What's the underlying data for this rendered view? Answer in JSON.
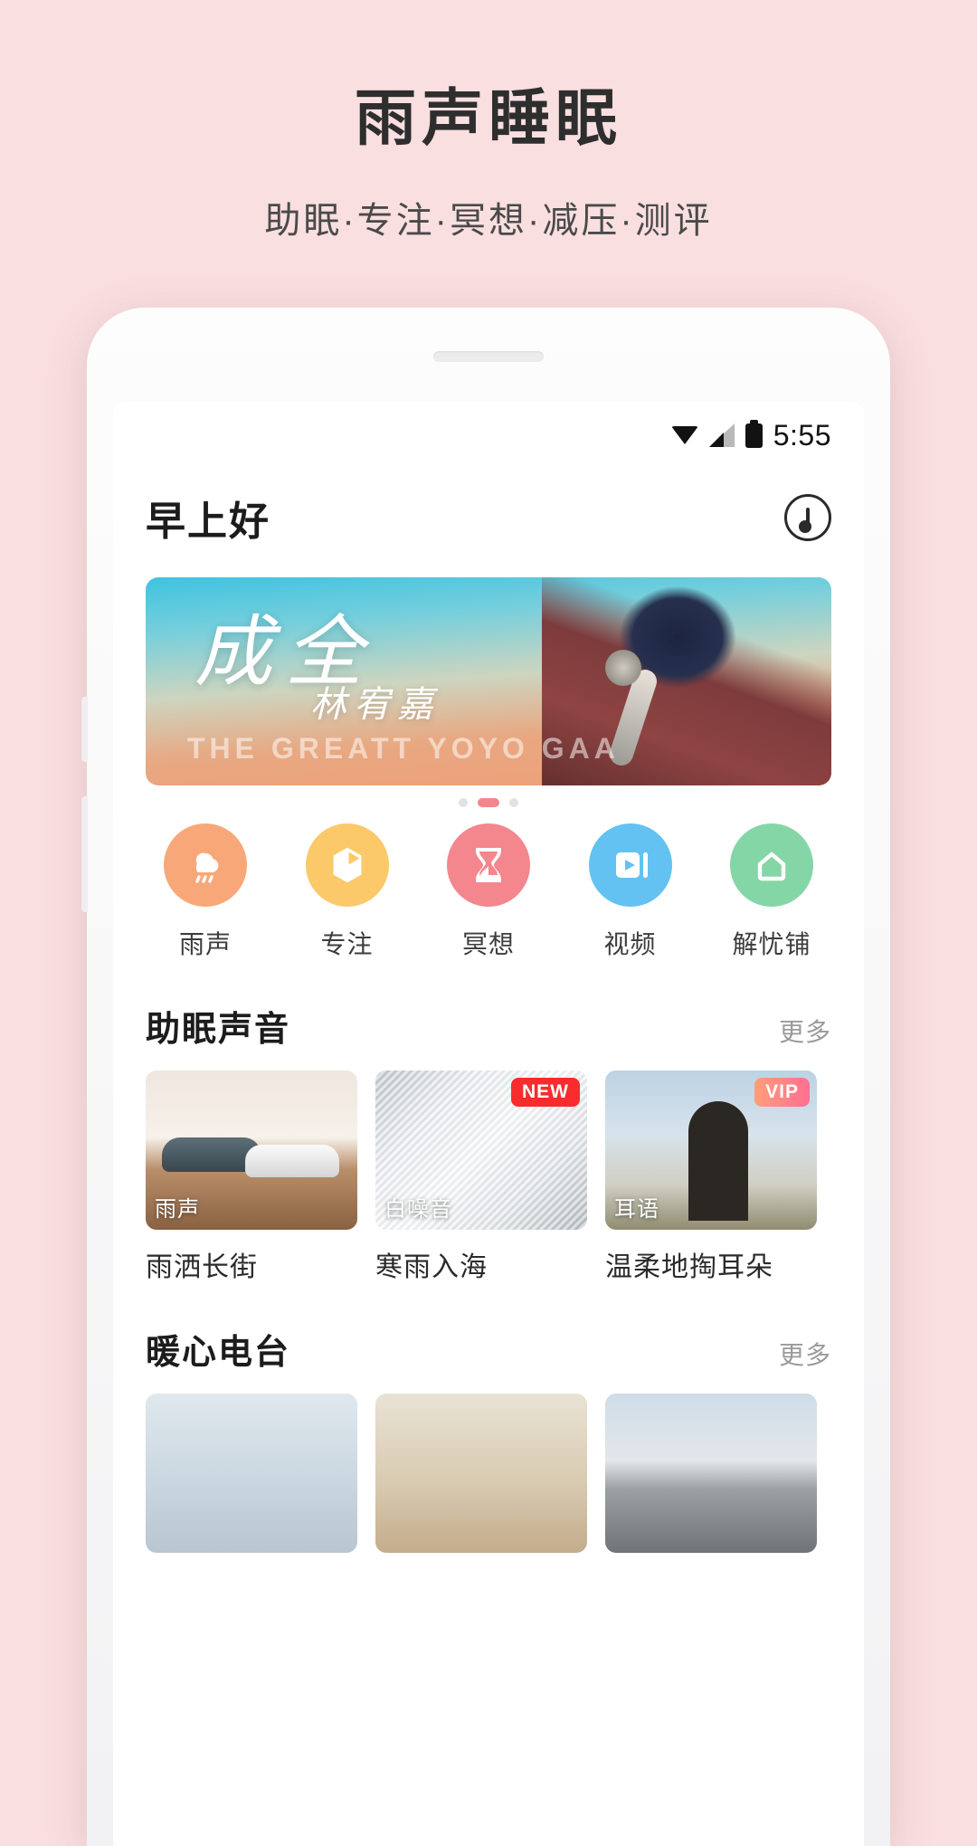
{
  "promo": {
    "title": "雨声睡眠",
    "subtitle": "助眠·专注·冥想·减压·测评"
  },
  "status_bar": {
    "time": "5:55",
    "wifi_icon": "wifi-icon",
    "signal_icon": "signal-icon",
    "battery_icon": "battery-icon"
  },
  "app_header": {
    "greeting": "早上好",
    "disc_icon": "music-disc-icon"
  },
  "banner": {
    "title_cn": "成全",
    "artist_cn": "林宥嘉",
    "title_en": "THE GREATT YOYO GAA",
    "dots_total": 3,
    "dots_active_index": 1
  },
  "categories": [
    {
      "label": "雨声",
      "icon": "rain-cloud-icon",
      "color": "#f8a878"
    },
    {
      "label": "专注",
      "icon": "hexagon-clock-icon",
      "color": "#fbc96a"
    },
    {
      "label": "冥想",
      "icon": "hourglass-icon",
      "color": "#f4868e"
    },
    {
      "label": "视频",
      "icon": "video-play-icon",
      "color": "#63c2f1"
    },
    {
      "label": "解忧铺",
      "icon": "house-icon",
      "color": "#85d6a6"
    }
  ],
  "sections": [
    {
      "title": "助眠声音",
      "more": "更多",
      "cards": [
        {
          "title": "雨洒长街",
          "tag": "雨声",
          "badge": "",
          "badge_kind": "",
          "art": "art-shoes"
        },
        {
          "title": "寒雨入海",
          "tag": "白噪音",
          "badge": "NEW",
          "badge_kind": "new",
          "art": "art-white"
        },
        {
          "title": "温柔地掏耳朵",
          "tag": "耳语",
          "badge": "VIP",
          "badge_kind": "vip",
          "art": "art-whisper"
        }
      ]
    },
    {
      "title": "暖心电台",
      "more": "更多",
      "cards": [
        {
          "title": "",
          "tag": "",
          "badge": "",
          "badge_kind": "",
          "art": "art-sea"
        },
        {
          "title": "",
          "tag": "",
          "badge": "",
          "badge_kind": "",
          "art": "art-sand"
        },
        {
          "title": "",
          "tag": "",
          "badge": "",
          "badge_kind": "",
          "art": "art-wall"
        }
      ]
    }
  ],
  "colors": {
    "page_bg": "#fadfe0",
    "accent": "#f4858e",
    "badge_new": "#f82c2c"
  }
}
